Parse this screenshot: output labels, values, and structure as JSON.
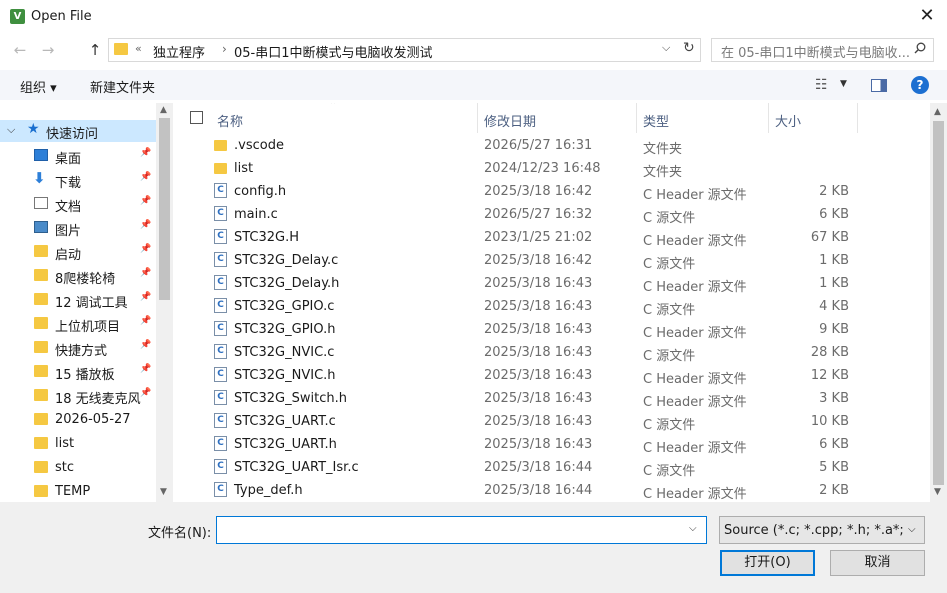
{
  "window": {
    "title": "Open File",
    "app_icon_letter": "V"
  },
  "nav": {
    "back_icon": "←",
    "forward_icon": "→",
    "up_icon": "↑",
    "breadcrumb": [
      "独立程序",
      "05-串口1中断模式与电脑收发测试"
    ],
    "breadcrumb_more": "«",
    "search_placeholder": "在 05-串口1中断模式与电脑收..."
  },
  "toolbar": {
    "organize": "组织 ▾",
    "new_folder": "新建文件夹"
  },
  "sidebar": {
    "quick_access": "快速访问",
    "items": [
      {
        "label": "桌面",
        "icon": "desktop-icon",
        "pinned": true
      },
      {
        "label": "下载",
        "icon": "download-icon",
        "pinned": true
      },
      {
        "label": "文档",
        "icon": "document-icon",
        "pinned": true
      },
      {
        "label": "图片",
        "icon": "picture-icon",
        "pinned": true
      },
      {
        "label": "启动",
        "icon": "folder-icon",
        "pinned": true
      },
      {
        "label": "8爬楼轮椅",
        "icon": "folder-icon",
        "pinned": true
      },
      {
        "label": "12  调试工具",
        "icon": "folder-icon",
        "pinned": true
      },
      {
        "label": "上位机项目",
        "icon": "folder-icon",
        "pinned": true
      },
      {
        "label": "快捷方式",
        "icon": "folder-icon",
        "pinned": true
      },
      {
        "label": "15 播放板",
        "icon": "folder-icon",
        "pinned": true
      },
      {
        "label": "18  无线麦克风",
        "icon": "folder-icon",
        "pinned": true
      },
      {
        "label": "2026-05-27",
        "icon": "folder-icon",
        "pinned": false
      },
      {
        "label": "list",
        "icon": "folder-icon",
        "pinned": false
      },
      {
        "label": "stc",
        "icon": "folder-icon",
        "pinned": false
      },
      {
        "label": "TEMP",
        "icon": "folder-icon",
        "pinned": false
      }
    ]
  },
  "columns": {
    "name": "名称",
    "date": "修改日期",
    "type": "类型",
    "size": "大小"
  },
  "files": [
    {
      "name": ".vscode",
      "date": "2026/5/27 16:31",
      "type": "文件夹",
      "size": "",
      "kind": "folder"
    },
    {
      "name": "list",
      "date": "2024/12/23 16:48",
      "type": "文件夹",
      "size": "",
      "kind": "folder"
    },
    {
      "name": "config.h",
      "date": "2025/3/18 16:42",
      "type": "C Header 源文件",
      "size": "2 KB",
      "kind": "c"
    },
    {
      "name": "main.c",
      "date": "2026/5/27 16:32",
      "type": "C 源文件",
      "size": "6 KB",
      "kind": "c"
    },
    {
      "name": "STC32G.H",
      "date": "2023/1/25 21:02",
      "type": "C Header 源文件",
      "size": "67 KB",
      "kind": "c"
    },
    {
      "name": "STC32G_Delay.c",
      "date": "2025/3/18 16:42",
      "type": "C 源文件",
      "size": "1 KB",
      "kind": "c"
    },
    {
      "name": "STC32G_Delay.h",
      "date": "2025/3/18 16:43",
      "type": "C Header 源文件",
      "size": "1 KB",
      "kind": "c"
    },
    {
      "name": "STC32G_GPIO.c",
      "date": "2025/3/18 16:43",
      "type": "C 源文件",
      "size": "4 KB",
      "kind": "c"
    },
    {
      "name": "STC32G_GPIO.h",
      "date": "2025/3/18 16:43",
      "type": "C Header 源文件",
      "size": "9 KB",
      "kind": "c"
    },
    {
      "name": "STC32G_NVIC.c",
      "date": "2025/3/18 16:43",
      "type": "C 源文件",
      "size": "28 KB",
      "kind": "c"
    },
    {
      "name": "STC32G_NVIC.h",
      "date": "2025/3/18 16:43",
      "type": "C Header 源文件",
      "size": "12 KB",
      "kind": "c"
    },
    {
      "name": "STC32G_Switch.h",
      "date": "2025/3/18 16:43",
      "type": "C Header 源文件",
      "size": "3 KB",
      "kind": "c"
    },
    {
      "name": "STC32G_UART.c",
      "date": "2025/3/18 16:43",
      "type": "C 源文件",
      "size": "10 KB",
      "kind": "c"
    },
    {
      "name": "STC32G_UART.h",
      "date": "2025/3/18 16:43",
      "type": "C Header 源文件",
      "size": "6 KB",
      "kind": "c"
    },
    {
      "name": "STC32G_UART_Isr.c",
      "date": "2025/3/18 16:44",
      "type": "C 源文件",
      "size": "5 KB",
      "kind": "c"
    },
    {
      "name": "Type_def.h",
      "date": "2025/3/18 16:44",
      "type": "C Header 源文件",
      "size": "2 KB",
      "kind": "c"
    }
  ],
  "footer": {
    "filename_label": "文件名(N):",
    "filename_value": "",
    "filter": "Source (*.c; *.cpp; *.h; *.a*; *.inc)",
    "open": "打开(O)",
    "cancel": "取消"
  },
  "colors": {
    "selected": "#cce8ff",
    "accent": "#0078d7",
    "folder": "#f5c842"
  }
}
